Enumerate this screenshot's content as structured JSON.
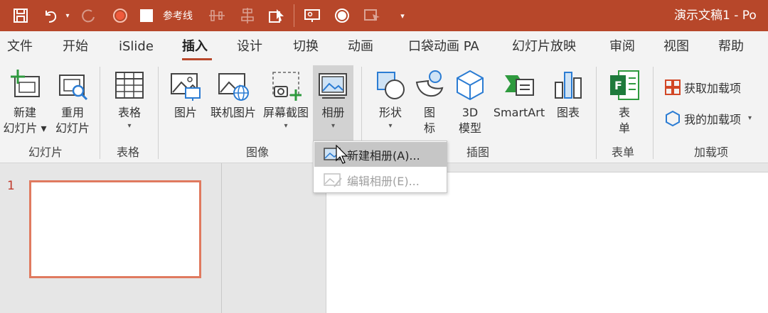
{
  "titlebar": {
    "qat_reference_line": "参考线",
    "doc_title": "演示文稿1  -  Po"
  },
  "tabs": [
    {
      "label": "文件"
    },
    {
      "label": "开始"
    },
    {
      "label": "iSlide"
    },
    {
      "label": "插入",
      "active": true
    },
    {
      "label": "设计"
    },
    {
      "label": "切换"
    },
    {
      "label": "动画"
    },
    {
      "label": "口袋动画 PA"
    },
    {
      "label": "幻灯片放映"
    },
    {
      "label": "审阅"
    },
    {
      "label": "视图"
    },
    {
      "label": "帮助"
    }
  ],
  "ribbon": {
    "new_slide": {
      "line1": "新建",
      "line2": "幻灯片 ▾"
    },
    "reuse_slide": {
      "line1": "重用",
      "line2": "幻灯片"
    },
    "table": {
      "label": "表格"
    },
    "picture": {
      "label": "图片"
    },
    "online_picture": {
      "label": "联机图片"
    },
    "screenshot": {
      "label": "屏幕截图"
    },
    "album": {
      "label": "相册"
    },
    "shapes": {
      "label": "形状"
    },
    "icons": {
      "line1": "图",
      "line2": "标"
    },
    "model3d": {
      "line1": "3D",
      "line2": "模型"
    },
    "smartart": {
      "label": "SmartArt"
    },
    "chart": {
      "label": "图表"
    },
    "form": {
      "line1": "表",
      "line2": "单"
    },
    "get_addins": {
      "label": "获取加载项"
    },
    "my_addins": {
      "label": "我的加载项"
    },
    "caret": "▾",
    "groups": {
      "slides": "幻灯片",
      "tables": "表格",
      "images": "图像",
      "illustrations": "插图",
      "forms": "表单",
      "addins": "加载项"
    }
  },
  "menu": {
    "new_album": "新建相册(A)...",
    "edit_album": "编辑相册(E)..."
  },
  "slides_pane": {
    "slide_number": "1"
  },
  "colors": {
    "accent": "#b7472a",
    "thumb_border": "#e07a5f"
  }
}
